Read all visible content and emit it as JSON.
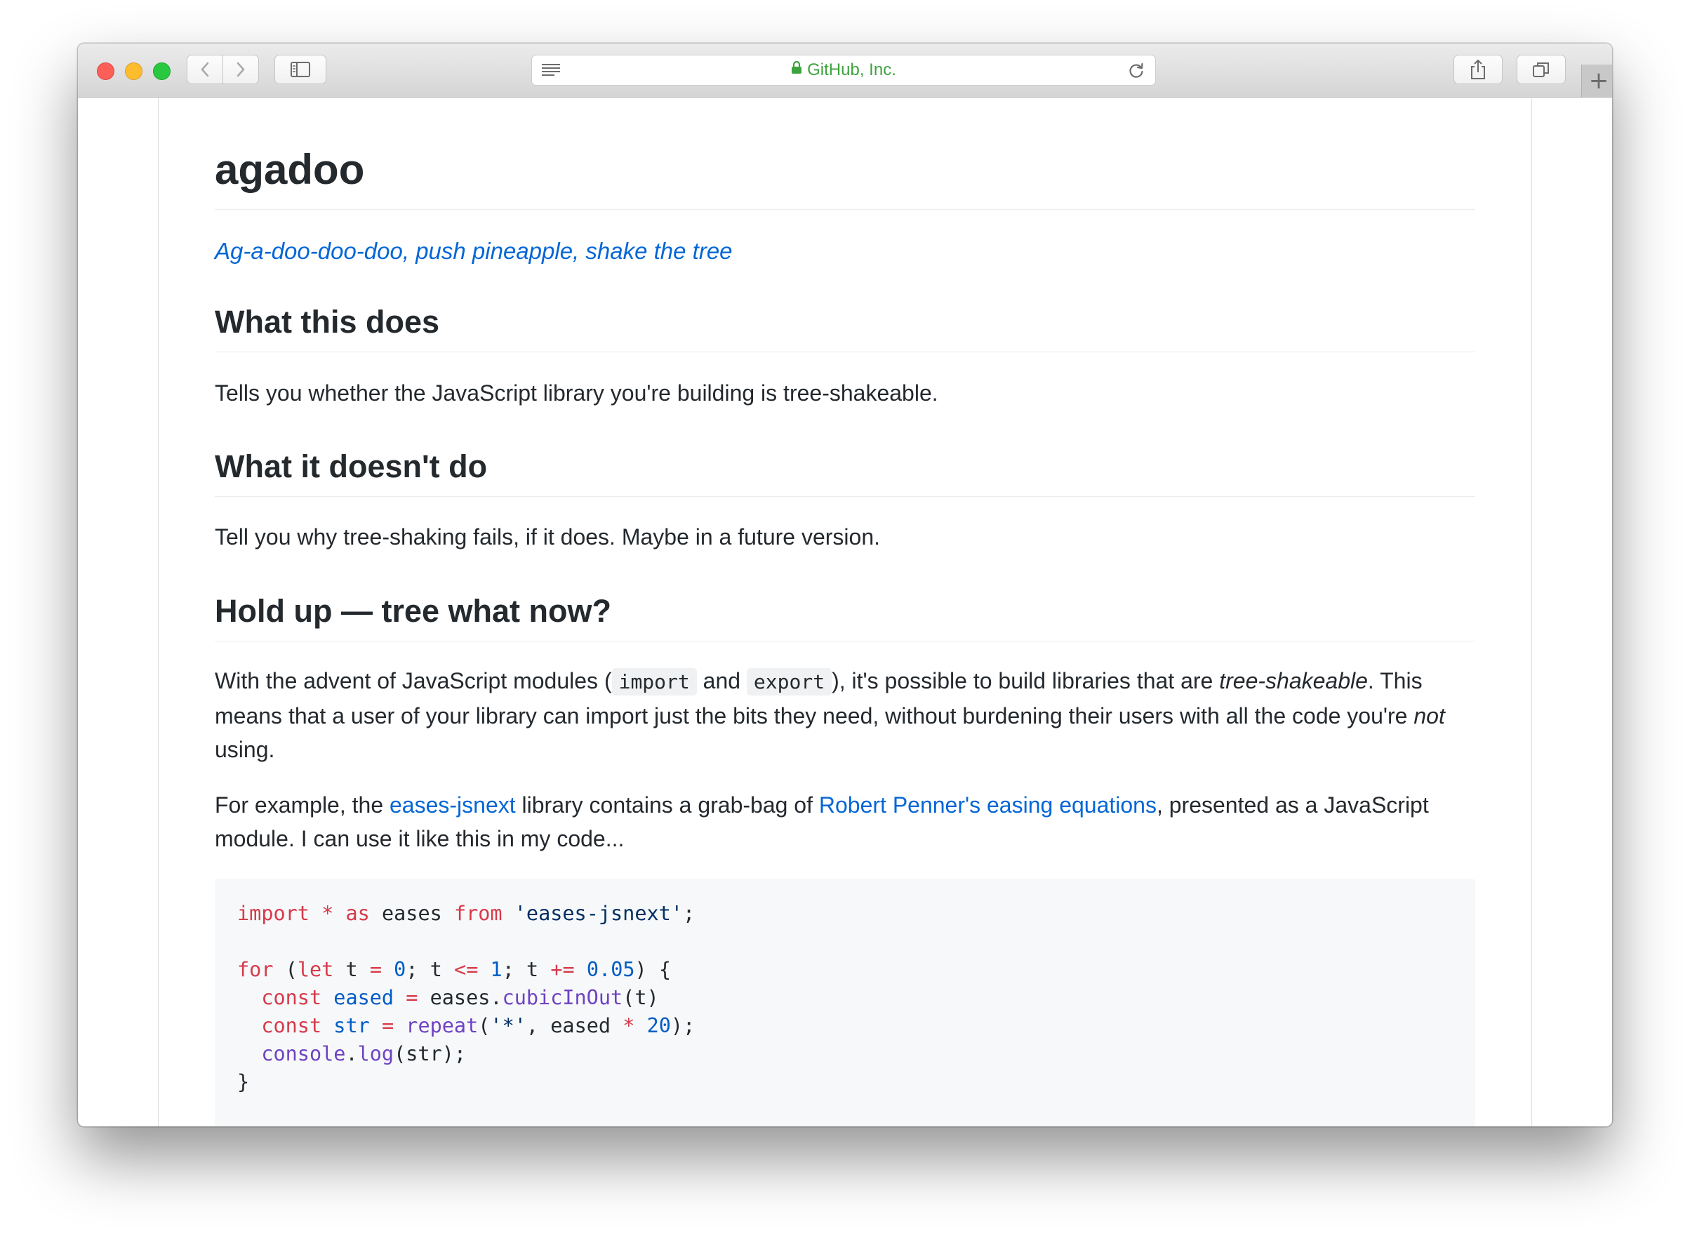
{
  "browser": {
    "address_text": "GitHub, Inc.",
    "new_tab_label": "+"
  },
  "readme": {
    "title": "agadoo",
    "tagline": "Ag-a-doo-doo-doo, push pineapple, shake the tree",
    "sections": [
      {
        "heading": "What this does",
        "body": "Tells you whether the JavaScript library you're building is tree-shakeable."
      },
      {
        "heading": "What it doesn't do",
        "body": "Tell you why tree-shaking fails, if it does. Maybe in a future version."
      },
      {
        "heading": "Hold up — tree what now?"
      }
    ],
    "modules_paragraph": {
      "p1": "With the advent of JavaScript modules (",
      "code1": "import",
      "p2": " and ",
      "code2": "export",
      "p3": "), it's possible to build libraries that are ",
      "em1": "tree-shakeable",
      "p4": ". This means that a user of your library can import just the bits they need, without burdening their users with all the code you're ",
      "em2": "not",
      "p5": " using."
    },
    "example_paragraph": {
      "p1": "For example, the ",
      "link1": "eases-jsnext",
      "p2": " library contains a grab-bag of ",
      "link2": "Robert Penner's easing equations",
      "p3": ", presented as a JavaScript module. I can use it like this in my code..."
    },
    "code_lines": [
      "import * as eases from 'eases-jsnext';",
      "",
      "for (let t = 0; t <= 1; t += 0.05) {",
      "  const eased = eases.cubicInOut(t)",
      "  const str = repeat('*', eased * 20);",
      "  console.log(str);",
      "}"
    ]
  }
}
